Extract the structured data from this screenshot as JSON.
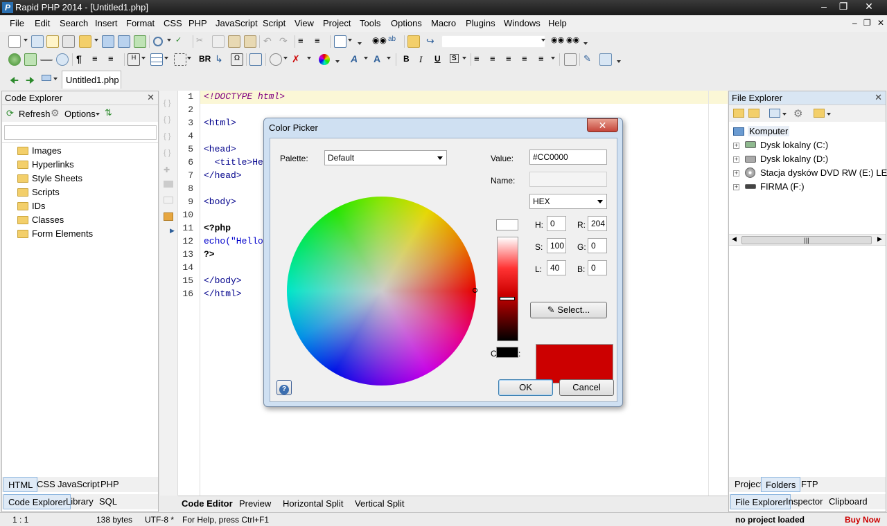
{
  "window": {
    "title": "Rapid PHP 2014 - [Untitled1.php]",
    "app_icon": "P"
  },
  "menu": {
    "items": [
      "File",
      "Edit",
      "Search",
      "Insert",
      "Format",
      "CSS",
      "PHP",
      "JavaScript",
      "Script",
      "View",
      "Project",
      "Tools",
      "Options",
      "Macro",
      "Plugins",
      "Windows",
      "Help"
    ]
  },
  "toolbar2": {
    "br_label": "BR",
    "bold": "B",
    "italic": "I",
    "underline": "U",
    "strike": "S"
  },
  "doc_tab": {
    "label": "Untitled1.php"
  },
  "code_explorer": {
    "title": "Code Explorer",
    "refresh_label": "Refresh",
    "options_label": "Options",
    "search_placeholder": "",
    "items": [
      "Images",
      "Hyperlinks",
      "Style Sheets",
      "Scripts",
      "IDs",
      "Classes",
      "Form Elements"
    ],
    "lang_tabs": [
      "HTML",
      "CSS",
      "JavaScript",
      "PHP"
    ],
    "panel_tabs": [
      "Code Explorer",
      "Library",
      "SQL"
    ]
  },
  "editor": {
    "line_numbers": [
      "1",
      "2",
      "3",
      "4",
      "5",
      "6",
      "7",
      "8",
      "9",
      "10",
      "11",
      "12",
      "13",
      "14",
      "15",
      "16"
    ],
    "lines": [
      "<!DOCTYPE html>",
      "",
      "<html>",
      "",
      "<head>",
      "  <title>He",
      "</head>",
      "",
      "<body>",
      "",
      "<?php",
      "echo(\"Hello",
      "?>",
      "",
      "</body>",
      "</html>"
    ],
    "tabs": [
      "Code Editor",
      "Preview",
      "Horizontal Split",
      "Vertical Split"
    ]
  },
  "file_explorer": {
    "title": "File Explorer",
    "root": "Komputer",
    "drives": [
      "Dysk lokalny (C:)",
      "Dysk lokalny (D:)",
      "Stacja dysków DVD RW (E:) LEJDIS",
      "FIRMA (F:)"
    ],
    "scroll_grip": "|||",
    "top_tabs": [
      "Project",
      "Folders",
      "FTP"
    ],
    "bottom_tabs": [
      "File Explorer",
      "Inspector",
      "Clipboard"
    ]
  },
  "statusbar": {
    "position": "1 : 1",
    "size": "138 bytes",
    "encoding": "UTF-8 *",
    "help": "For Help, press Ctrl+F1",
    "project": "no project loaded",
    "buy": "Buy Now"
  },
  "color_picker": {
    "title": "Color Picker",
    "palette_label": "Palette:",
    "palette_value": "Default",
    "value_label": "Value:",
    "value": "#CC0000",
    "name_label": "Name:",
    "name_value": "",
    "format_value": "HEX",
    "h_label": "H:",
    "h": "0",
    "s_label": "S:",
    "s": "100",
    "l_label": "L:",
    "l": "40",
    "r_label": "R:",
    "r": "204",
    "g_label": "G:",
    "g": "0",
    "b_label": "B:",
    "b": "0",
    "select_label": "Select...",
    "current_label": "Current:",
    "current_color": "#CC0000",
    "ok_label": "OK",
    "cancel_label": "Cancel",
    "help_glyph": "?"
  },
  "colors": {
    "accent": "#2a6fb0",
    "buy_now": "#cc0000"
  }
}
